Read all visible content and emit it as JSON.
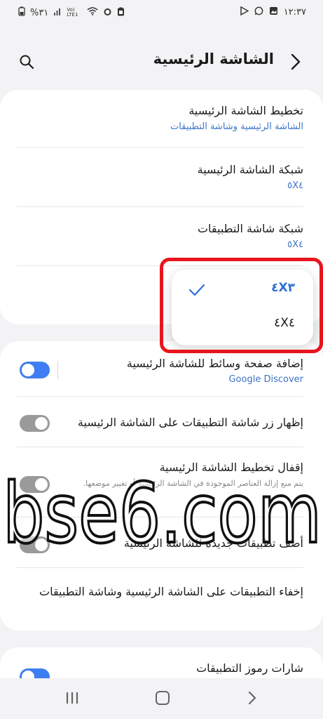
{
  "status_bar": {
    "time": "١٢:٣٧",
    "battery": "%٣١",
    "network_label": "Vo) LTE1"
  },
  "header": {
    "title": "الشاشة الرئيسية"
  },
  "settings": {
    "home_layout": {
      "title": "تخطيط الشاشة الرئيسية",
      "value": "الشاشة الرئيسية وشاشة التطبيقات"
    },
    "home_grid": {
      "title": "شبكة الشاشة الرئيسية",
      "value": "٥X٤"
    },
    "apps_grid": {
      "title": "شبكة شاشة التطبيقات",
      "value": "٥X٤"
    }
  },
  "grid_popup": {
    "options": [
      "٤X٣",
      "٤X٤"
    ],
    "selected": "٤X٣"
  },
  "toggles": {
    "media_page": {
      "title": "إضافة صفحة وسائط للشاشة الرئيسية",
      "value": "Google Discover",
      "state": "on"
    },
    "apps_button": {
      "title": "إظهار زر شاشة التطبيقات على الشاشة الرئيسية",
      "state": "off"
    },
    "lock_layout": {
      "title": "إقفال تخطيط الشاشة الرئيسية",
      "description": "يتم منع إزالة العناصر الموجودة في الشاشة الرئيسية أو تغيير موضعها.",
      "state": "off"
    },
    "add_new_apps": {
      "title": "أضف تطبيقات جديدة للشاشة الرئيسية",
      "state": "off"
    },
    "hide_apps": {
      "title": "إخفاء التطبيقات على الشاشة الرئيسية وشاشة التطبيقات"
    },
    "app_badges": {
      "title": "شارات رموز التطبيقات",
      "state": "on"
    }
  },
  "watermark": {
    "text": "bse6.com"
  },
  "colors": {
    "accent": "#3f7ef2",
    "link": "#3b74c9",
    "highlight_outline": "#e8141c"
  }
}
